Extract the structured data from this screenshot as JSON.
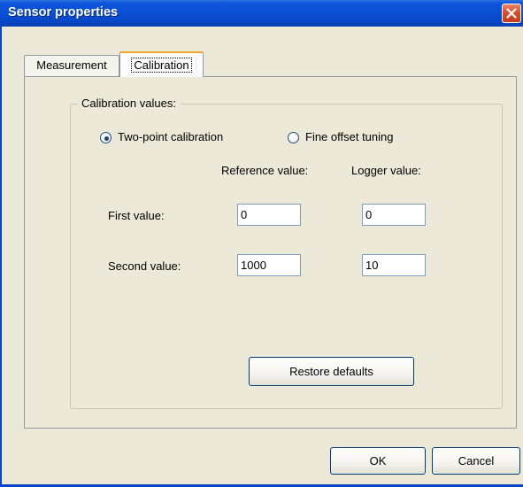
{
  "window": {
    "title": "Sensor properties",
    "close_icon": "close-icon"
  },
  "tabs": [
    {
      "label": "Measurement",
      "active": false
    },
    {
      "label": "Calibration",
      "active": true
    }
  ],
  "calibration": {
    "group_label": "Calibration values:",
    "mode_options": [
      {
        "label": "Two-point calibration",
        "selected": true
      },
      {
        "label": "Fine offset tuning",
        "selected": false
      }
    ],
    "column_headers": {
      "reference": "Reference value:",
      "logger": "Logger value:"
    },
    "rows": [
      {
        "label": "First value:",
        "reference": "0",
        "logger": "0"
      },
      {
        "label": "Second value:",
        "reference": "1000",
        "logger": "10"
      }
    ],
    "restore_label": "Restore defaults"
  },
  "footer": {
    "ok_label": "OK",
    "cancel_label": "Cancel"
  },
  "colors": {
    "titlebar": "#0a4fd3",
    "close_button": "#d8502e",
    "dialog_background": "#ece9d8",
    "active_tab_accent": "#f2a536"
  }
}
